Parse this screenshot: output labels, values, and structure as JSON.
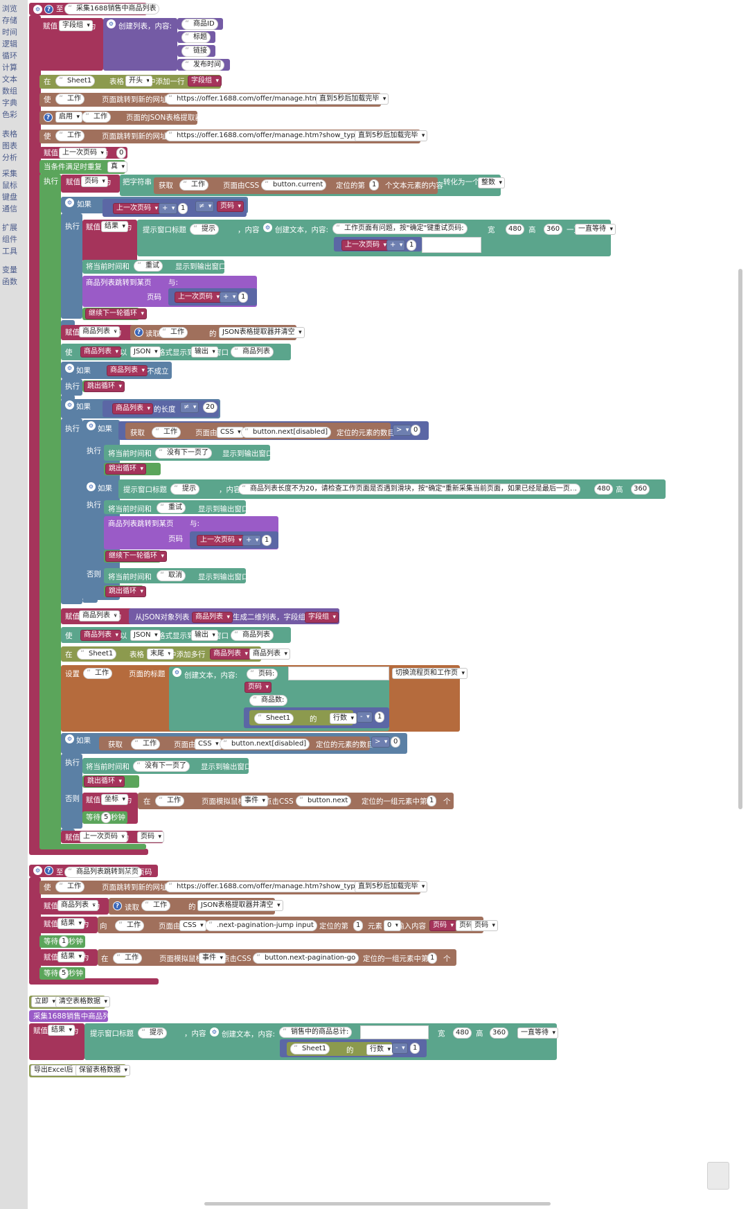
{
  "sidebar": {
    "categories": [
      "浏览",
      "存储",
      "时间",
      "逻辑",
      "循环",
      "计算",
      "文本",
      "数组",
      "字典",
      "色彩",
      "表格",
      "图表",
      "分析",
      "采集",
      "鼠标",
      "键盘",
      "通信",
      "扩展",
      "组件",
      "工具",
      "变量",
      "函数"
    ]
  },
  "proc1": {
    "def_label": "至",
    "name": "采集1688销售中商品列表",
    "assign": "赋值",
    "var_fields": "字段组",
    "as": "为",
    "create_list": "创建列表，内容:",
    "f1": "商品ID",
    "f2": "标题",
    "f3": "链接",
    "f4": "发布时间",
    "at": "在",
    "sheet1": "Sheet1",
    "table": "表格",
    "start": "开头",
    "add_row": "中添加一行",
    "make": "使",
    "work": "工作",
    "goto_url": "页面跳转到新的网址",
    "url1": "https://offer.1688.com/offer/manage.htm",
    "wait_loaded": "直到5秒后加载完毕",
    "enable": "启用",
    "json_extractor": "页面的JSON表格提取器",
    "url2": "https://offer.1688.com/offer/manage.htm?show_typ…",
    "var_last_page": "上一次页码",
    "zero": "0",
    "while": "当条件满足时重复",
    "true": "真",
    "exec": "执行",
    "var_page": "页码",
    "convert_str": "把字符串",
    "fetch": "获取",
    "by_css": "页面由CSS",
    "css_current": "button.current",
    "locate_nth": "定位的第",
    "one": "1",
    "text_content": "个文本元素的内容",
    "convert_to": "转化为一个",
    "integer": "整数",
    "if": "如果",
    "plus": "+",
    "neq": "≠",
    "var_result": "结果",
    "prompt_title": "提示窗口标题",
    "tip": "提示",
    "content": "，内容",
    "create_text": "创建文本，内容:",
    "err_msg": "工作页面有问题，按\"确定\"键重试页码:",
    "width": "宽",
    "w480": "480",
    "height": "高",
    "h360": "360",
    "wait_forever": "一直等待",
    "log_time": "将当前时间和",
    "retry": "重试",
    "show_output": "显示到输出窗口",
    "call_goto": "商品列表跳转到某页",
    "with": "与:",
    "page_param": "页码",
    "continue": "继续下一轮循环",
    "var_goods": "商品列表",
    "read": "读取",
    "of": "的",
    "json_read_clear": "JSON表格提取器并清空",
    "show_as": "以",
    "json": "JSON",
    "format_show": "格式显示到",
    "output": "输出",
    "window": "窗口",
    "goods_list_str": "商品列表",
    "not": "不成立",
    "break": "跳出循环",
    "length": "的长度",
    "twenty": "20",
    "css": "CSS",
    "css_disabled": "button.next[disabled]",
    "elem_count": "定位的元素的数目",
    "gt": ">",
    "no_next": "没有下一页了",
    "long_msg": "商品列表长度不为20，请检查工作页面是否遇到滑块，按\"确定\"重新采集当前页面，如果已经是最后一页…",
    "else": "否则",
    "cancel": "取消",
    "from_json": "从JSON对象列表",
    "gen_2d": "生成二维列表，字段组",
    "end": "末尾",
    "add_rows": "中添加多行",
    "set": "设置",
    "page_title": "页面的标题",
    "page_label": "页码:",
    "goods_count": "商品数:",
    "rows": "行数",
    "minus": "-",
    "switch_tabs": "切换流程页和工作页",
    "var_coord": "坐标",
    "mouse_sim": "页面模拟鼠标",
    "event": "事件",
    "click_css": "点击CSS",
    "css_next": "button.next",
    "locate_group": "定位的一组元素中第",
    "item": "个",
    "wait": "等待",
    "five": "5",
    "seconds": "秒钟"
  },
  "proc2": {
    "name": "商品列表跳转到某页",
    "with": "与: 页码",
    "into": "向",
    "css_jump": ".next-pagination-jump input",
    "elem": "元素",
    "type_content": "输入内容",
    "css_go": "button.next-pagination-go"
  },
  "bottom": {
    "now": "立即",
    "clear_table": "清空表格数据",
    "call_proc": "采集1688销售中商品列表",
    "total_msg": "销售中的商品总计:",
    "export_after": "导出Excel后",
    "keep_data": "保留表格数据"
  }
}
